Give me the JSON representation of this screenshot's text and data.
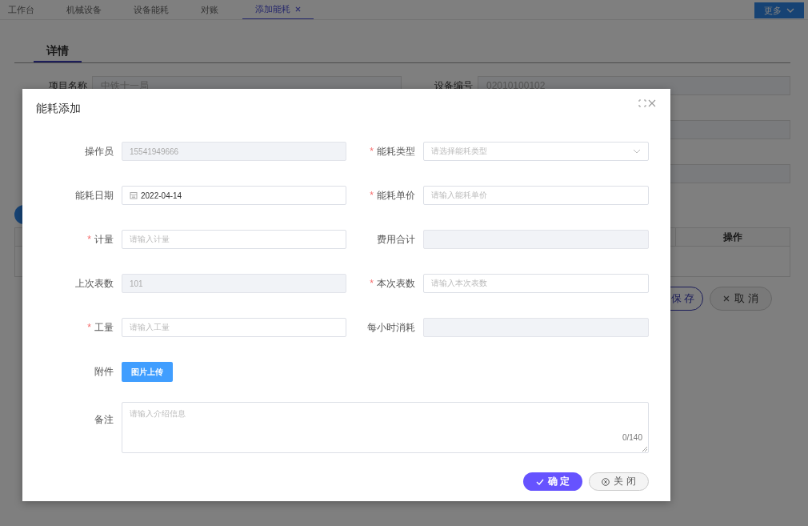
{
  "tabs": [
    {
      "label": "工作台",
      "selected": false,
      "closable": false
    },
    {
      "label": "机械设备",
      "selected": false,
      "closable": false
    },
    {
      "label": "设备能耗",
      "selected": false,
      "closable": false
    },
    {
      "label": "对账",
      "selected": false,
      "closable": false
    },
    {
      "label": "添加能耗",
      "selected": true,
      "closable": true
    }
  ],
  "more_button": {
    "label": "更多"
  },
  "page": {
    "section_title": "详情",
    "fields": [
      {
        "label": "项目名称",
        "value": "中铁十一局"
      },
      {
        "label": "设备编号",
        "value": "02010100102"
      }
    ],
    "table": {
      "columns": [
        "操作"
      ]
    },
    "buttons": [
      {
        "label": "保存",
        "kind": "primary"
      },
      {
        "label": "取消",
        "kind": "cancel"
      }
    ]
  },
  "dialog": {
    "title": "能耗添加",
    "fields": [
      {
        "label": "操作员",
        "kind": "input",
        "disabled": true,
        "value": "15541949666"
      },
      {
        "label": "能耗类型",
        "required_mark": "*",
        "kind": "select",
        "disabled": false,
        "placeholder": "请选择能耗类型"
      },
      {
        "label": "能耗日期",
        "kind": "date",
        "disabled": false,
        "value": "2022-04-14"
      },
      {
        "label": "能耗单价",
        "required_mark": "*",
        "kind": "input",
        "disabled": false,
        "placeholder": "请输入能耗单价"
      },
      {
        "label": "计量",
        "required_mark": "*",
        "kind": "input",
        "disabled": false,
        "placeholder": "请输入计量"
      },
      {
        "label": "费用合计",
        "kind": "input",
        "disabled": true
      },
      {
        "label": "上次表数",
        "kind": "input",
        "disabled": true,
        "value": "101"
      },
      {
        "label": "本次表数",
        "required_mark": "*",
        "kind": "input",
        "disabled": false,
        "placeholder": "请输入本次表数"
      },
      {
        "label": "工量",
        "required_mark": "*",
        "kind": "input",
        "disabled": false,
        "placeholder": "请输入工量"
      },
      {
        "label": "每小时消耗",
        "kind": "input",
        "disabled": true
      }
    ],
    "attachment": {
      "label": "附件",
      "button": "图片上传"
    },
    "remark": {
      "label": "备注",
      "placeholder": "请输入介绍信息",
      "counter": "0/140"
    },
    "buttons": [
      {
        "label": "确定",
        "kind": "primary"
      },
      {
        "label": "关闭",
        "kind": "close"
      }
    ]
  }
}
